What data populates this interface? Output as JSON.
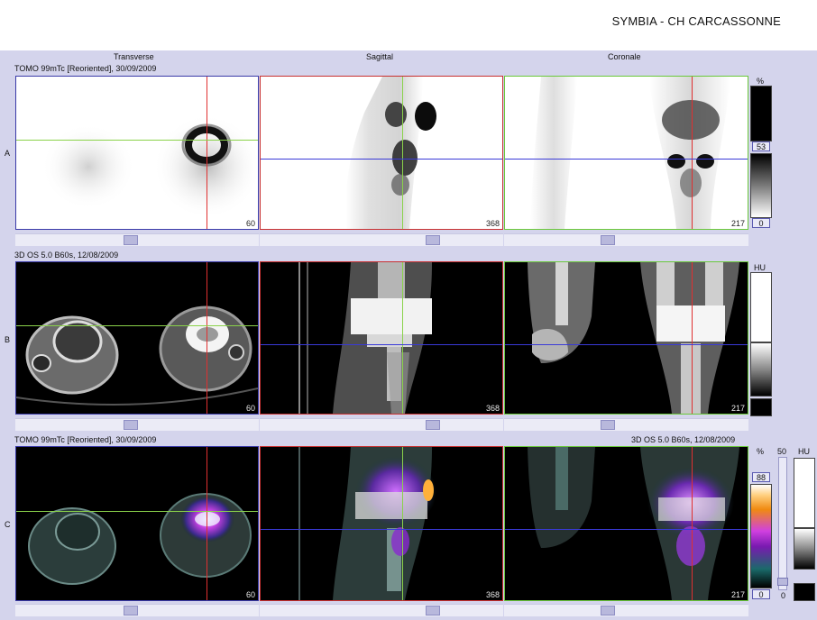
{
  "header": {
    "title": "SYMBIA - CH CARCASSONNE"
  },
  "columns": {
    "transverse": "Transverse",
    "sagittal": "Sagittal",
    "coronal": "Coronale"
  },
  "rows": {
    "a": {
      "label": "A",
      "series": "TOMO 99mTc [Reoriented], 30/09/2009",
      "slices": [
        "60",
        "368",
        "217"
      ]
    },
    "b": {
      "label": "B",
      "series": "3D  OS  5.0  B60s, 12/08/2009",
      "slices": [
        "60",
        "368",
        "217"
      ]
    },
    "c": {
      "label": "C",
      "series_left": "TOMO 99mTc [Reoriented], 30/09/2009",
      "series_right": "3D  OS  5.0  B60s, 12/08/2009",
      "slices": [
        "60",
        "368",
        "217"
      ]
    }
  },
  "scales": {
    "a": {
      "unit": "%",
      "value": "53",
      "min": "0"
    },
    "b": {
      "unit": "HU"
    },
    "c": {
      "unit_pct": "%",
      "value": "88",
      "min": "0",
      "blend_max": "50",
      "blend_min": "0",
      "unit_hu": "HU"
    }
  },
  "colors": {
    "crosshair_red": "#e03030",
    "crosshair_green": "#9ad84a",
    "crosshair_blue": "#3a3ad8",
    "panel_bg": "#d4d4ec"
  }
}
